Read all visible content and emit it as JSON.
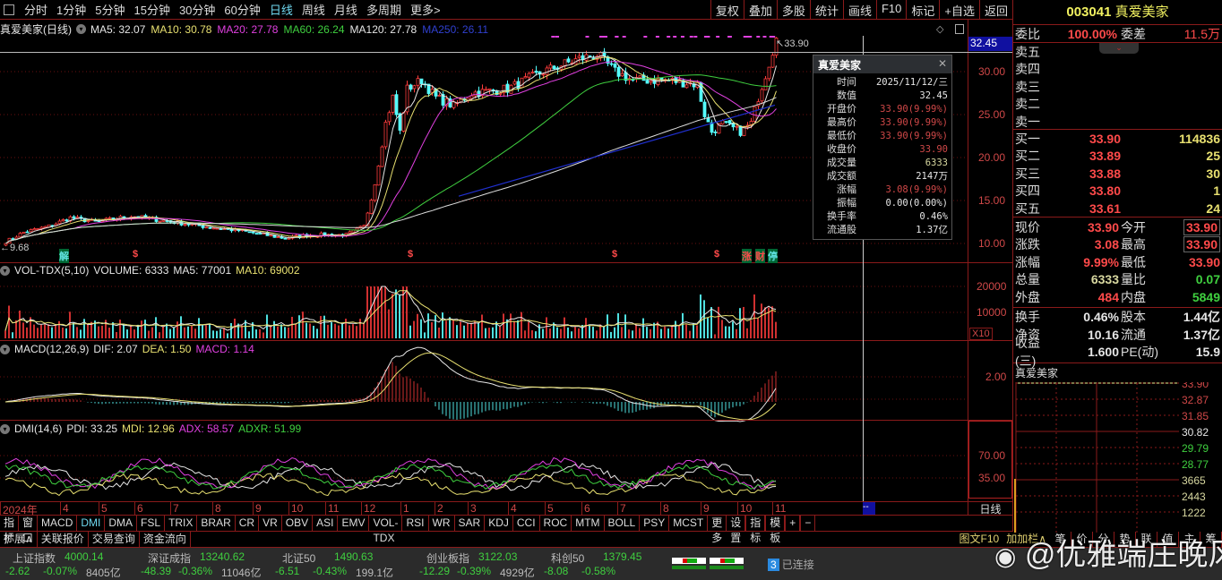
{
  "toolbar": {
    "periods": [
      "分时",
      "1分钟",
      "5分钟",
      "15分钟",
      "30分钟",
      "60分钟",
      "日线",
      "周线",
      "月线",
      "多周期",
      "更多>"
    ],
    "active": "日线",
    "actions": [
      "复权",
      "叠加",
      "多股",
      "统计",
      "画线",
      "F10",
      "标记",
      "+自选",
      "返回"
    ]
  },
  "price_panel": {
    "title": "真爱美家(日线)",
    "ma": [
      {
        "label": "MA5: 32.07",
        "color": "#e6e6e6"
      },
      {
        "label": "MA10: 30.78",
        "color": "#e8e070"
      },
      {
        "label": "MA20: 27.78",
        "color": "#e040e0"
      },
      {
        "label": "MA60: 26.24",
        "color": "#3fcf3f"
      },
      {
        "label": "MA120: 27.78",
        "color": "#e6e6e6"
      },
      {
        "label": "MA250: 26.11",
        "color": "#3040d0"
      }
    ],
    "y_ticks": [
      "30.00",
      "25.00",
      "20.00",
      "15.00",
      "10.00"
    ],
    "current_label": "32.45",
    "high_label": "33.90",
    "low_label": "9.68",
    "markers": [
      {
        "t": "解",
        "c": "#5fe0e0"
      },
      {
        "t": "$",
        "c": "#ff4a4a"
      },
      {
        "t": "$",
        "c": "#ff4a4a"
      },
      {
        "t": "$",
        "c": "#ff4a4a"
      },
      {
        "t": "$",
        "c": "#ff4a4a"
      },
      {
        "t": "涨",
        "c": "#ff4a4a"
      },
      {
        "t": "财",
        "c": "#ff4a4a"
      },
      {
        "t": "停",
        "c": "#5fe0e0"
      }
    ]
  },
  "price_series": {
    "keypoints": [
      [
        0,
        10.2
      ],
      [
        5,
        11.3
      ],
      [
        12,
        12
      ],
      [
        18,
        13
      ],
      [
        25,
        12.5
      ],
      [
        35,
        13.2
      ],
      [
        45,
        12.6
      ],
      [
        55,
        12
      ],
      [
        65,
        11.5
      ],
      [
        78,
        10.6
      ],
      [
        85,
        11
      ],
      [
        95,
        11
      ],
      [
        100,
        12
      ],
      [
        103,
        17
      ],
      [
        106,
        24
      ],
      [
        108,
        27
      ],
      [
        110,
        23
      ],
      [
        112,
        28
      ],
      [
        116,
        29
      ],
      [
        120,
        27
      ],
      [
        125,
        26
      ],
      [
        130,
        27.5
      ],
      [
        140,
        28
      ],
      [
        150,
        30
      ],
      [
        160,
        31.5
      ],
      [
        165,
        32
      ],
      [
        170,
        30
      ],
      [
        175,
        29
      ],
      [
        185,
        29
      ],
      [
        193,
        28.5
      ],
      [
        195,
        25
      ],
      [
        197,
        23
      ],
      [
        200,
        24
      ],
      [
        205,
        23
      ],
      [
        208,
        24
      ],
      [
        210,
        27
      ],
      [
        213,
        31
      ],
      [
        215,
        33.9
      ]
    ]
  },
  "popup": {
    "title": "真爱美家",
    "rows": [
      {
        "k": "时间",
        "v": "2025/11/12/三",
        "c": "#e6e6e6"
      },
      {
        "k": "数值",
        "v": "32.45",
        "c": "#e6e6e6"
      },
      {
        "k": "开盘价",
        "v": "33.90(9.99%)",
        "c": "#d04848"
      },
      {
        "k": "最高价",
        "v": "33.90(9.99%)",
        "c": "#d04848"
      },
      {
        "k": "最低价",
        "v": "33.90(9.99%)",
        "c": "#d04848"
      },
      {
        "k": "收盘价",
        "v": "33.90",
        "c": "#d04848"
      },
      {
        "k": "成交量",
        "v": "6333",
        "c": "#d8d8a0"
      },
      {
        "k": "成交额",
        "v": "2147万",
        "c": "#e6e6e6"
      },
      {
        "k": "涨幅",
        "v": "3.08(9.99%)",
        "c": "#d04848"
      },
      {
        "k": "振幅",
        "v": "0.00(0.00%)",
        "c": "#e6e6e6"
      },
      {
        "k": "换手率",
        "v": "0.46%",
        "c": "#e6e6e6"
      },
      {
        "k": "流通股",
        "v": "1.37亿",
        "c": "#e6e6e6"
      }
    ]
  },
  "volume_panel": {
    "name": "VOL-TDX(5,10)",
    "volume": "VOLUME: 6333",
    "ma5": "MA5: 77001",
    "ma10": "MA10: 69002",
    "y_ticks": [
      "20000",
      "10000"
    ],
    "unit": "X10"
  },
  "macd_panel": {
    "name": "MACD(12,26,9)",
    "dif": "DIF: 2.07",
    "dea": "DEA: 1.50",
    "macd": "MACD: 1.14",
    "y_ticks": [
      "2.00"
    ]
  },
  "dmi_panel": {
    "name": "DMI(14,6)",
    "pdi": "PDI: 33.25",
    "mdi": "MDI: 12.96",
    "adx": "ADX: 58.57",
    "adxr": "ADXR: 51.99",
    "y_ticks": [
      "70.00",
      "35.00"
    ]
  },
  "date_axis": [
    "2024年",
    "4",
    "5",
    "6",
    "7",
    "8",
    "9",
    "10",
    "11",
    "12",
    "1",
    "2",
    "3",
    "4",
    "5",
    "6",
    "7",
    "8",
    "9",
    "10",
    "11"
  ],
  "date_cursor": "--",
  "period_label": "日线",
  "indicator_tabs": [
    "指标A",
    "窗口",
    "MACD",
    "DMI",
    "DMA",
    "FSL",
    "TRIX",
    "BRAR",
    "CR",
    "VR",
    "OBV",
    "ASI",
    "EMV",
    "VOL-TDX",
    "RSI",
    "WR",
    "SAR",
    "KDJ",
    "CCI",
    "ROC",
    "MTM",
    "BOLL",
    "PSY",
    "MCST",
    "更多",
    "设置"
  ],
  "indicator_active": "DMI",
  "indicator_right": [
    "指标B",
    "模 板",
    "+",
    "−"
  ],
  "ext_tabs": [
    "扩展∧",
    "关联报价",
    "交易查询",
    "资金流向"
  ],
  "ext_right": [
    "图文F10",
    "加加栏∧",
    "笔",
    "价",
    "分",
    "势",
    "联",
    "值",
    "主",
    "筹"
  ],
  "quote": {
    "code": "003041",
    "name": "真爱美家",
    "weibi_label": "委比",
    "weibi": "100.00%",
    "weicha_label": "委差",
    "weicha": "11.5万",
    "sell": [
      {
        "k": "卖五",
        "p": "",
        "q": ""
      },
      {
        "k": "卖四",
        "p": "",
        "q": ""
      },
      {
        "k": "卖三",
        "p": "",
        "q": ""
      },
      {
        "k": "卖二",
        "p": "",
        "q": ""
      },
      {
        "k": "卖一",
        "p": "",
        "q": ""
      }
    ],
    "buy": [
      {
        "k": "买一",
        "p": "33.90",
        "q": "114836"
      },
      {
        "k": "买二",
        "p": "33.89",
        "q": "25"
      },
      {
        "k": "买三",
        "p": "33.88",
        "q": "30"
      },
      {
        "k": "买四",
        "p": "33.80",
        "q": "1"
      },
      {
        "k": "买五",
        "p": "33.61",
        "q": "24"
      }
    ],
    "stats": [
      {
        "k1": "现价",
        "v1": "33.90",
        "c1": "#ff4a4a",
        "k2": "今开",
        "v2": "33.90",
        "c2": "#ff4a4a",
        "box": true
      },
      {
        "k1": "涨跌",
        "v1": "3.08",
        "c1": "#ff4a4a",
        "k2": "最高",
        "v2": "33.90",
        "c2": "#ff4a4a",
        "box": true
      },
      {
        "k1": "涨幅",
        "v1": "9.99%",
        "c1": "#ff4a4a",
        "k2": "最低",
        "v2": "33.90",
        "c2": "#ff4a4a"
      },
      {
        "k1": "总量",
        "v1": "6333",
        "c1": "#d8d8a0",
        "k2": "量比",
        "v2": "0.07",
        "c2": "#3fcf3f"
      },
      {
        "k1": "外盘",
        "v1": "484",
        "c1": "#ff4a4a",
        "k2": "内盘",
        "v2": "5849",
        "c2": "#3fcf3f"
      }
    ],
    "fundamentals": [
      {
        "k1": "换手",
        "v1": "0.46%",
        "k2": "股本",
        "v2": "1.44亿"
      },
      {
        "k1": "净资",
        "v1": "10.16",
        "k2": "流通",
        "v2": "1.37亿"
      },
      {
        "k1": "收益(三)",
        "v1": "1.600",
        "k2": "PE(动)",
        "v2": "15.9"
      }
    ]
  },
  "mini_chart": {
    "title": "真爱美家",
    "labels": [
      {
        "t": "33.90",
        "c": "#d04848"
      },
      {
        "t": "32.87",
        "c": "#d04848"
      },
      {
        "t": "31.85",
        "c": "#d04848"
      },
      {
        "t": "30.82",
        "c": "#e6e6e6"
      },
      {
        "t": "29.79",
        "c": "#3fcf3f"
      },
      {
        "t": "28.77",
        "c": "#3fcf3f"
      },
      {
        "t": "3665",
        "c": "#d8d8a0"
      },
      {
        "t": "2443",
        "c": "#d8d8a0"
      },
      {
        "t": "1222",
        "c": "#d8d8a0"
      }
    ]
  },
  "indices": [
    {
      "name": "上证指数",
      "value": "4000.14",
      "chg": "-2.62",
      "pct": "-0.07%",
      "amt": "8405亿"
    },
    {
      "name": "深证成指",
      "value": "13240.62",
      "chg": "-48.39",
      "pct": "-0.36%",
      "amt": "11046亿"
    },
    {
      "name": "北证50",
      "value": "1490.63",
      "chg": "-6.51",
      "pct": "-0.43%",
      "amt": "199.1亿"
    },
    {
      "name": "创业板指",
      "value": "3122.03",
      "chg": "-12.29",
      "pct": "-0.39%",
      "amt": "4929亿"
    },
    {
      "name": "科创50",
      "value": "1379.45",
      "chg": "-8.08",
      "pct": "-0.58%",
      "amt": ""
    }
  ],
  "connection": {
    "count": "3",
    "label": "已连接"
  },
  "watermark": "@优雅端庄晚风"
}
